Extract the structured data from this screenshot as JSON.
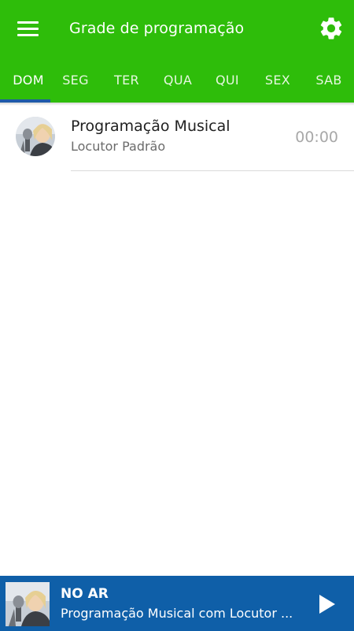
{
  "header": {
    "title": "Grade de programação",
    "menu_icon": "menu-icon",
    "settings_icon": "gear-icon",
    "background_color": "#2ebd0a"
  },
  "tabs": [
    {
      "label": "DOM",
      "active": true
    },
    {
      "label": "SEG",
      "active": false
    },
    {
      "label": "TER",
      "active": false
    },
    {
      "label": "QUA",
      "active": false
    },
    {
      "label": "QUI",
      "active": false
    },
    {
      "label": "SEX",
      "active": false
    },
    {
      "label": "SAB",
      "active": false
    }
  ],
  "tab_indicator_color": "#1e5aa8",
  "schedule": [
    {
      "title": "Programação Musical",
      "host": "Locutor Padrão",
      "time": "00:00",
      "avatar": "host-photo"
    }
  ],
  "player": {
    "label": "NO AR",
    "track": "Programação Musical com Locutor Padrão",
    "play_icon": "play-icon",
    "background_color": "#0f5fa8"
  }
}
